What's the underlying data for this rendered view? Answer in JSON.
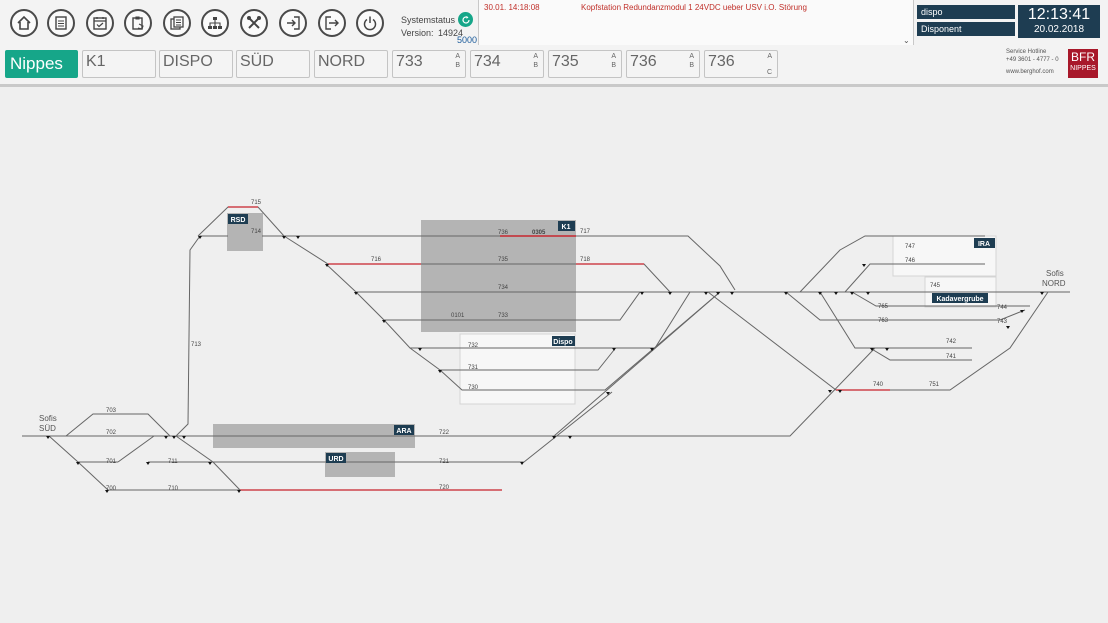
{
  "toolbar": {
    "icons": [
      "home-icon",
      "document-list-icon",
      "calendar-check-icon",
      "clipboard-hand-icon",
      "print-preview-icon",
      "network-icon",
      "tools-icon",
      "login-icon",
      "logout-icon",
      "power-icon"
    ],
    "system_status_label": "Systemstatus",
    "version_label": "Version:",
    "version_value": "14924",
    "version_extra": "5000"
  },
  "alarm": {
    "date": "30.01.  14:18:08",
    "text": "Kopfstation Redundanzmodul 1 24VDC ueber USV i.O. Störung"
  },
  "user": {
    "name": "dispo",
    "role": "Disponent"
  },
  "clock": {
    "time": "12:13:41",
    "date": "20.02.2018"
  },
  "tabs": [
    {
      "label": "Nippes",
      "active": true
    },
    {
      "label": "K1"
    },
    {
      "label": "DISPO"
    },
    {
      "label": "SÜD"
    },
    {
      "label": "NORD"
    },
    {
      "label": "733",
      "sub": [
        "A",
        "B"
      ]
    },
    {
      "label": "734",
      "sub": [
        "A",
        "B"
      ]
    },
    {
      "label": "735",
      "sub": [
        "A",
        "B"
      ]
    },
    {
      "label": "736",
      "sub": [
        "A",
        "B"
      ]
    },
    {
      "label": "736",
      "sub": [
        "A",
        "C"
      ]
    }
  ],
  "service": {
    "hotline_label": "Service Hotline",
    "phone": "+49 3601 - 4777 - 0",
    "url": "www.berghof.com"
  },
  "logo": {
    "main": "BFR",
    "sub": "NIPPES"
  },
  "diagram": {
    "places": {
      "south": [
        "Sofis",
        "SÜD"
      ],
      "north": [
        "Sofis",
        "NORD"
      ]
    },
    "zones": [
      "RSD",
      "K1",
      "Dispo",
      "IRA",
      "Kadavergrube",
      "ARA",
      "URD"
    ],
    "track_numbers": [
      "715",
      "714",
      "713",
      "717",
      "736",
      "0305",
      "716",
      "735",
      "718",
      "734",
      "0101",
      "733",
      "732",
      "731",
      "730",
      "703",
      "702",
      "701",
      "711",
      "700",
      "710",
      "722",
      "721",
      "720",
      "747",
      "746",
      "745",
      "765",
      "744",
      "763",
      "743",
      "742",
      "741",
      "740",
      "751"
    ],
    "colors": {
      "track": "#666666",
      "occupied": "#c8202a",
      "zone_fill": "#b4b4b4",
      "zone_label_bg": "#1e3d52"
    }
  }
}
